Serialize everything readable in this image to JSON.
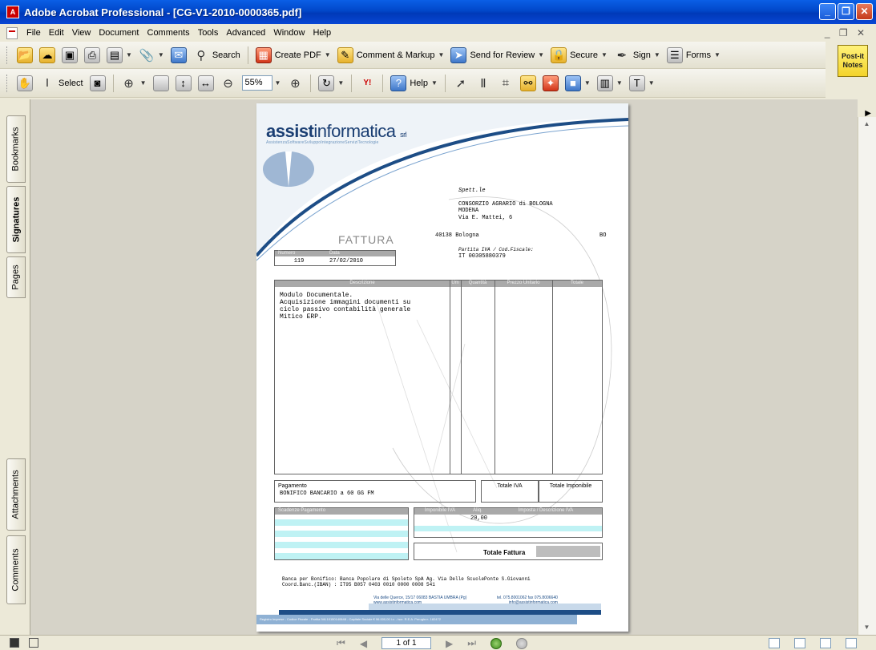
{
  "window": {
    "title": "Adobe Acrobat Professional - [CG-V1-2010-0000365.pdf]"
  },
  "menu": [
    "File",
    "Edit",
    "View",
    "Document",
    "Comments",
    "Tools",
    "Advanced",
    "Window",
    "Help"
  ],
  "toolbar1": {
    "search_label": "Search",
    "create_pdf_label": "Create PDF",
    "comment_markup_label": "Comment & Markup",
    "send_review_label": "Send for Review",
    "secure_label": "Secure",
    "sign_label": "Sign",
    "forms_label": "Forms"
  },
  "toolbar2": {
    "select_label": "Select",
    "zoom_value": "55%",
    "help_label": "Help"
  },
  "postit": {
    "line1": "Post-it",
    "line2": "Notes"
  },
  "nav_tabs": [
    "Bookmarks",
    "Signatures",
    "Pages",
    "Attachments",
    "Comments"
  ],
  "document": {
    "company_bold": "assist",
    "company_rest": "informatica",
    "company_suffix": "srl",
    "tagline": "AssistenzaSoftwareSviluppoIntegrazioneServiziTecnologie",
    "recipient_label": "Spett.le",
    "recipient_name": "CONSORZIO AGRARIO di BOLOGNA",
    "recipient_line2": "MODENA",
    "recipient_address": "Via E. Mattei, 6",
    "recipient_cap_city": "40138 Bologna",
    "recipient_province": "BO",
    "vat_label": "Partita IVA / Cod.Fiscale:",
    "vat_value": "IT 00305880379",
    "doc_type": "FATTURA",
    "number_header": "Numero",
    "date_header": "Data",
    "number_value": "119",
    "date_value": "27/02/2010",
    "col_descr": "Descrizione",
    "col_um": "Um",
    "col_qty": "Quantità",
    "col_price": "Prezzo Unitario",
    "col_total": "Totale",
    "description_lines": [
      "Modulo Documentale.",
      "Acquisizione immagini documenti su",
      "ciclo passivo contabilità generale",
      "Mitico ERP."
    ],
    "payment_label": "Pagamento",
    "payment_value": "BONIFICO BANCARIO a 60 GG FM",
    "total_iva_label": "Totale IVA",
    "total_imponibile_label": "Totale Imponibile",
    "scadenze_label": "Scadenze Pagamento",
    "imponibile_iva_label": "Imponibile IVA",
    "aliq_label": "Aliq.",
    "imposta_label": "Imposta / Descrizione IVA",
    "aliq_value": "20,00",
    "totale_fattura_label": "Totale Fattura",
    "bank_line1": "Banca per Bonifico: Banca Popolare di Spoleto SpA Ag. Via Delle ScuolePonte S.Giovanni",
    "bank_line2": "Coord.Banc.(IBAN) : IT95 B057 0403 0010 0000 0008 541",
    "footer_addr1": "Via delle Querce, 15/17 06083 BASTIA UMBRA (Pg)",
    "footer_addr2": "www.assistinformatica.com",
    "footer_tel": "tel. 075.8001062 fax 075.8006640",
    "footer_mail": "info@assistinformatica.com",
    "footer_registry": "Registro Imprese - Codice Fiscale - Partita IVA 10150140648 - Capitale Sociale € 96.000,00 i.v. - Iscr. R.E.A. Perugia n. 182472"
  },
  "status": {
    "page_indicator": "1 of 1"
  }
}
